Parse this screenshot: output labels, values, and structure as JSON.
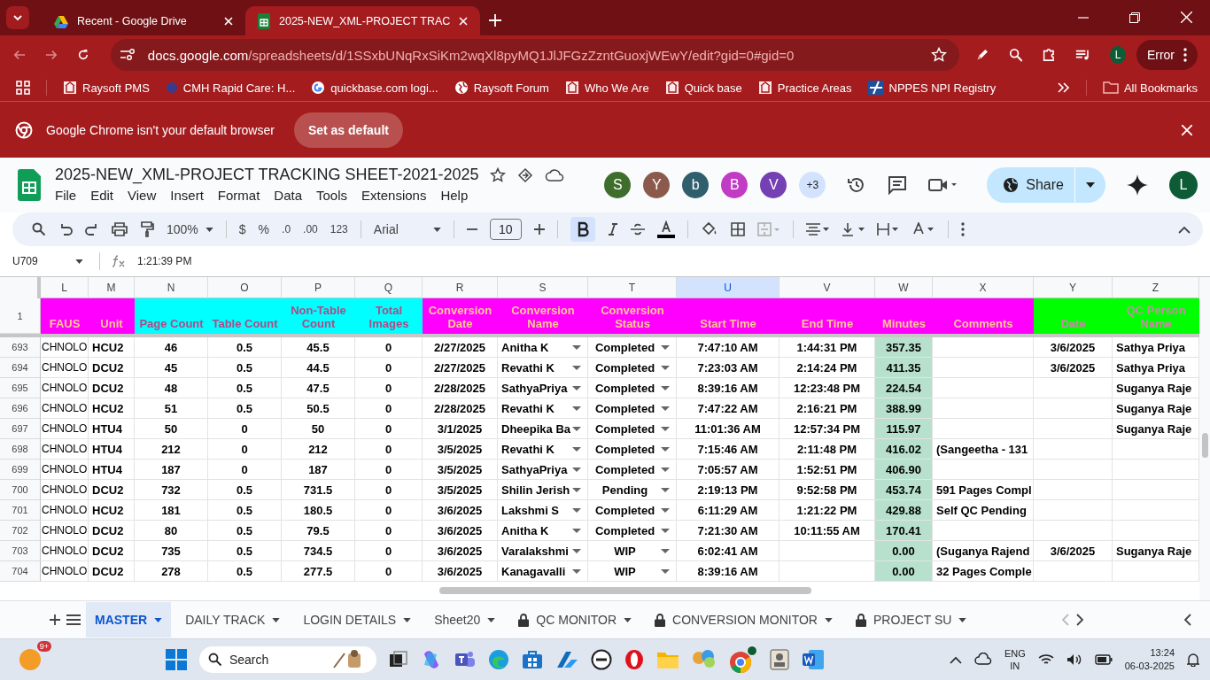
{
  "browser": {
    "tabs": [
      {
        "title": "Recent - Google Drive",
        "selected": false
      },
      {
        "title": "2025-NEW_XML-PROJECT TRAC",
        "selected": true
      }
    ],
    "url_host": "docs.google.com",
    "url_path": "/spreadsheets/d/1SSxbUNqRxSiKm2wqXl8pyMQ1JlJFGzZzntGuoxjWEwY/edit?gid=0#gid=0",
    "profile": "L",
    "error_label": "Error",
    "bookmarks": [
      "Raysoft PMS",
      "CMH Rapid Care: H...",
      "quickbase.com logi...",
      "Raysoft Forum",
      "Who We Are",
      "Quick base",
      "Practice Areas",
      "NPPES NPI Registry"
    ],
    "all_bookmarks": "All Bookmarks",
    "infobar": {
      "message": "Google Chrome isn't your default browser",
      "button": "Set as default"
    }
  },
  "sheet": {
    "title": "2025-NEW_XML-PROJECT TRACKING SHEET-2021-2025",
    "menu": [
      "File",
      "Edit",
      "View",
      "Insert",
      "Format",
      "Data",
      "Tools",
      "Extensions",
      "Help"
    ],
    "collaborators": [
      {
        "initial": "S",
        "color": "#3f6e2c"
      },
      {
        "initial": "Y",
        "color": "#8c5a4c"
      },
      {
        "initial": "b",
        "color": "#2f5f6d"
      },
      {
        "initial": "B",
        "color": "#c23bc4"
      },
      {
        "initial": "V",
        "color": "#7440b3"
      }
    ],
    "more_collaborators": "+3",
    "share": "Share",
    "account": "L"
  },
  "toolbar": {
    "zoom": "100%",
    "currency": "$",
    "percent": "%",
    "decrease_decimals": ".0",
    "increase_decimals": ".00",
    "number_format": "123",
    "font": "Arial",
    "font_size": "10",
    "bold": true
  },
  "formula_bar": {
    "cell": "U709",
    "value": "1:21:39 PM"
  },
  "grid": {
    "columns": [
      {
        "letter": "L",
        "header": "FAUS",
        "kind": "conversion",
        "selected": false,
        "dropdown": false,
        "shaded": false
      },
      {
        "letter": "M",
        "header": "Unit",
        "kind": "conversion",
        "selected": false,
        "dropdown": false,
        "shaded": false
      },
      {
        "letter": "N",
        "header": "Page Count",
        "kind": "count",
        "selected": false,
        "dropdown": false,
        "shaded": false
      },
      {
        "letter": "O",
        "header": "Table Count",
        "kind": "count",
        "selected": false,
        "dropdown": false,
        "shaded": false
      },
      {
        "letter": "P",
        "header": "Non-Table Count",
        "kind": "count",
        "selected": false,
        "dropdown": false,
        "shaded": false
      },
      {
        "letter": "Q",
        "header": "Total Images",
        "kind": "count",
        "selected": false,
        "dropdown": false,
        "shaded": false
      },
      {
        "letter": "R",
        "header": "Conversion Date",
        "kind": "conversion",
        "selected": false,
        "dropdown": false,
        "shaded": false
      },
      {
        "letter": "S",
        "header": "Conversion Name",
        "kind": "conversion",
        "selected": false,
        "dropdown": true,
        "shaded": false
      },
      {
        "letter": "T",
        "header": "Conversion Status",
        "kind": "conversion",
        "selected": false,
        "dropdown": true,
        "shaded": false
      },
      {
        "letter": "U",
        "header": "Start Time",
        "kind": "conversion",
        "selected": true,
        "dropdown": false,
        "shaded": false
      },
      {
        "letter": "V",
        "header": "End Time",
        "kind": "conversion",
        "selected": false,
        "dropdown": false,
        "shaded": false
      },
      {
        "letter": "W",
        "header": "Minutes",
        "kind": "conversion",
        "selected": false,
        "dropdown": false,
        "shaded": true
      },
      {
        "letter": "X",
        "header": "Comments",
        "kind": "conversion",
        "selected": false,
        "dropdown": false,
        "shaded": false
      },
      {
        "letter": "Y",
        "header": "Date",
        "kind": "qc",
        "selected": false,
        "dropdown": false,
        "shaded": false
      },
      {
        "letter": "Z",
        "header": "QC Person Name",
        "kind": "qc",
        "selected": false,
        "dropdown": false,
        "shaded": false
      }
    ],
    "header_row": "1",
    "rows": [
      {
        "number": "693",
        "cells": [
          "CHNOLO",
          "HCU2",
          "46",
          "0.5",
          "45.5",
          "0",
          "2/27/2025",
          "Anitha K",
          "Completed",
          "7:47:10 AM",
          "1:44:31 PM",
          "357.35",
          null,
          "3/6/2025",
          "Sathya Priya"
        ]
      },
      {
        "number": "694",
        "cells": [
          "CHNOLO",
          "DCU2",
          "45",
          "0.5",
          "44.5",
          "0",
          "2/27/2025",
          "Revathi K",
          "Completed",
          "7:23:03 AM",
          "2:14:24 PM",
          "411.35",
          null,
          "3/6/2025",
          "Sathya Priya"
        ]
      },
      {
        "number": "695",
        "cells": [
          "CHNOLO",
          "DCU2",
          "48",
          "0.5",
          "47.5",
          "0",
          "2/28/2025",
          "SathyaPriya",
          "Completed",
          "8:39:16 AM",
          "12:23:48 PM",
          "224.54",
          null,
          null,
          "Suganya Raje"
        ]
      },
      {
        "number": "696",
        "cells": [
          "CHNOLO",
          "HCU2",
          "51",
          "0.5",
          "50.5",
          "0",
          "2/28/2025",
          "Revathi K",
          "Completed",
          "7:47:22 AM",
          "2:16:21 PM",
          "388.99",
          null,
          null,
          "Suganya Raje"
        ]
      },
      {
        "number": "697",
        "cells": [
          "CHNOLO",
          "HTU4",
          "50",
          "0",
          "50",
          "0",
          "3/1/2025",
          "Dheepika Ba",
          "Completed",
          "11:01:36 AM",
          "12:57:34 PM",
          "115.97",
          null,
          null,
          "Suganya Raje"
        ]
      },
      {
        "number": "698",
        "cells": [
          "CHNOLO",
          "HTU4",
          "212",
          "0",
          "212",
          "0",
          "3/5/2025",
          "Revathi K",
          "Completed",
          "7:15:46 AM",
          "2:11:48 PM",
          "416.02",
          "(Sangeetha - 131",
          null,
          null
        ]
      },
      {
        "number": "699",
        "cells": [
          "CHNOLO",
          "HTU4",
          "187",
          "0",
          "187",
          "0",
          "3/5/2025",
          "SathyaPriya",
          "Completed",
          "7:05:57 AM",
          "1:52:51 PM",
          "406.90",
          null,
          null,
          null
        ]
      },
      {
        "number": "700",
        "cells": [
          "CHNOLO",
          "DCU2",
          "732",
          "0.5",
          "731.5",
          "0",
          "3/5/2025",
          "Shilin Jerish",
          "Pending",
          "2:19:13 PM",
          "9:52:58 PM",
          "453.74",
          "591 Pages Compl",
          null,
          null
        ]
      },
      {
        "number": "701",
        "cells": [
          "CHNOLO",
          "HCU2",
          "181",
          "0.5",
          "180.5",
          "0",
          "3/6/2025",
          "Lakshmi S",
          "Completed",
          "6:11:29 AM",
          "1:21:22 PM",
          "429.88",
          "Self QC Pending",
          null,
          null
        ]
      },
      {
        "number": "702",
        "cells": [
          "CHNOLO",
          "DCU2",
          "80",
          "0.5",
          "79.5",
          "0",
          "3/6/2025",
          "Anitha K",
          "Completed",
          "7:21:30 AM",
          "10:11:55 AM",
          "170.41",
          null,
          null,
          null
        ]
      },
      {
        "number": "703",
        "cells": [
          "CHNOLO",
          "DCU2",
          "735",
          "0.5",
          "734.5",
          "0",
          "3/6/2025",
          "Varalakshmi",
          "WIP",
          "6:02:41 AM",
          null,
          "0.00",
          "(Suganya Rajend",
          "3/6/2025",
          "Suganya Raje"
        ]
      },
      {
        "number": "704",
        "cells": [
          "CHNOLO",
          "DCU2",
          "278",
          "0.5",
          "277.5",
          "0",
          "3/6/2025",
          "Kanagavalli",
          "WIP",
          "8:39:16 AM",
          null,
          "0.00",
          "32 Pages Comple",
          null,
          null
        ]
      }
    ]
  },
  "sheet_tabs": [
    {
      "label": "MASTER",
      "selected": true,
      "locked": false
    },
    {
      "label": "DAILY TRACK",
      "selected": false,
      "locked": false
    },
    {
      "label": "LOGIN DETAILS",
      "selected": false,
      "locked": false
    },
    {
      "label": "Sheet20",
      "selected": false,
      "locked": false
    },
    {
      "label": "QC MONITOR",
      "selected": false,
      "locked": true
    },
    {
      "label": "CONVERSION MONITOR",
      "selected": false,
      "locked": true
    },
    {
      "label": "PROJECT SU",
      "selected": false,
      "locked": true
    }
  ],
  "taskbar": {
    "badge": "9+",
    "search": "Search",
    "language": "ENG",
    "region": "IN",
    "time": "13:24",
    "date": "06-03-2025"
  }
}
